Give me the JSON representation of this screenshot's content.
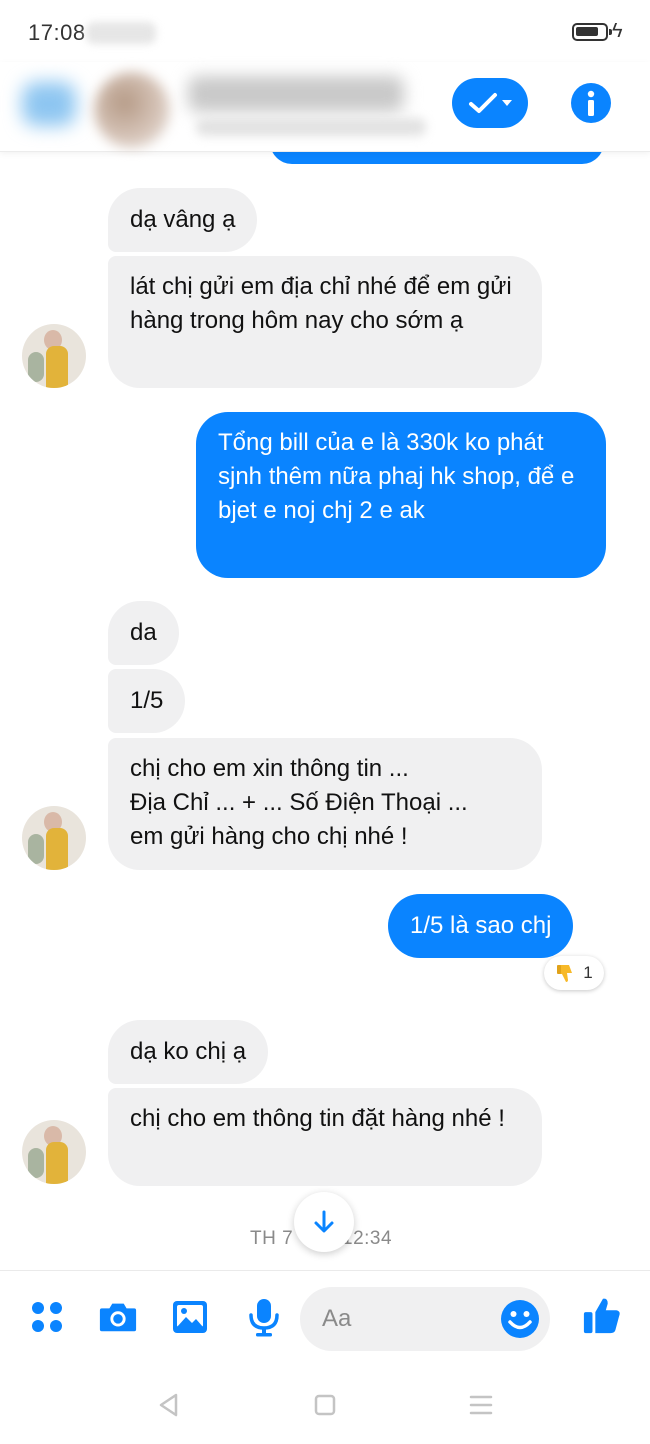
{
  "status_bar": {
    "time": "17:08",
    "battery_level": 0.8
  },
  "colors": {
    "accent": "#0a84ff",
    "incoming_bubble": "#f0f0f1",
    "outgoing_text": "#ffffff"
  },
  "header": {
    "icons": [
      "back-arrow-icon",
      "contact-avatar",
      "checkmark-icon",
      "info-icon"
    ]
  },
  "messages": {
    "m1": "dạ vâng ạ",
    "m2": "lát chị gửi em địa chỉ nhé để em gửi hàng trong hôm nay cho sớm ạ",
    "m3": "Tổng bill của e là 330k ko phát sjnh thêm nữa phaj hk shop, để e bjet e noj chj 2 e ak",
    "m4": "da",
    "m5": "1/5",
    "m6_l1": "chị  cho em xin thông tin ...",
    "m6_l2": "Địa Chỉ ... + ... Số Điện Thoại ...",
    "m6_l3": "em gửi hàng cho chị nhé !",
    "m7": "1/5 là sao chj",
    "m8": "dạ ko chị ạ",
    "m9": "chị cho em thông tin đặt hàng nhé !"
  },
  "reaction": {
    "icon": "thumbs-down-icon",
    "count": "1"
  },
  "timestamp": {
    "left": "TH 7",
    "right": "12:34"
  },
  "composer": {
    "placeholder": "Aa",
    "tools": [
      "menu-dots-icon",
      "camera-icon",
      "gallery-icon",
      "microphone-icon",
      "emoji-icon",
      "thumbs-up-icon"
    ]
  },
  "nav": [
    "back-icon",
    "home-icon",
    "recents-icon"
  ]
}
